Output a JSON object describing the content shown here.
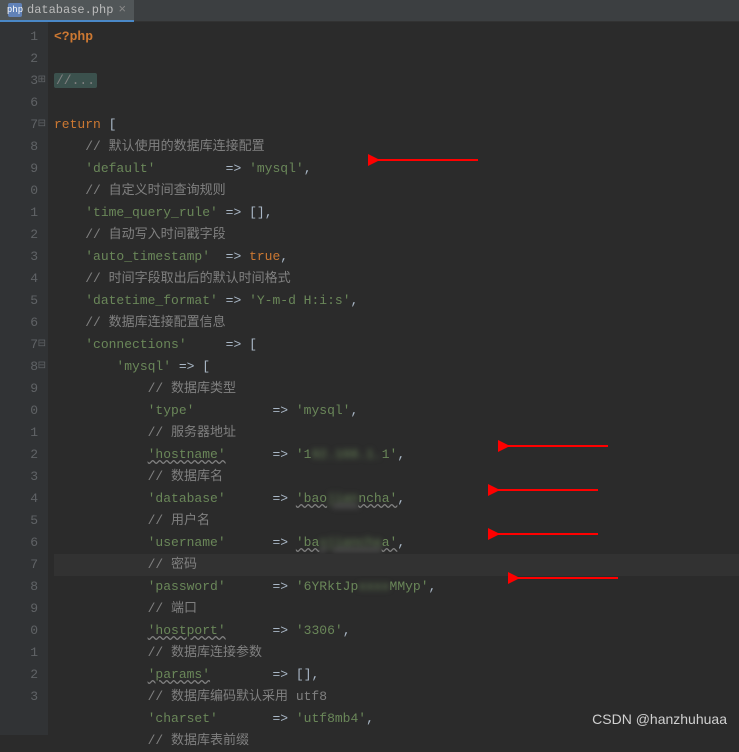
{
  "tab": {
    "label": "database.php",
    "icon": "php"
  },
  "gutter_lines": [
    "1",
    "2",
    "3",
    "6",
    "7",
    "8",
    "9",
    "0",
    "1",
    "2",
    "3",
    "4",
    "5",
    "6",
    "7",
    "8",
    "9",
    "0",
    "1",
    "2",
    "3",
    "4",
    "5",
    "6",
    "7",
    "8",
    "9",
    "0",
    "1",
    "2",
    "3"
  ],
  "code": {
    "php_open": "<?php",
    "fold": "//...",
    "return": "return",
    "cmt_default": "// 默认使用的数据库连接配置",
    "k_default": "'default'",
    "v_default": "'mysql'",
    "cmt_time_query": "// 自定义时间查询规则",
    "k_time_query": "'time_query_rule'",
    "v_time_query": "[]",
    "cmt_auto_ts": "// 自动写入时间戳字段",
    "k_auto_ts": "'auto_timestamp'",
    "v_auto_ts": "true",
    "cmt_dt_fmt": "// 时间字段取出后的默认时间格式",
    "k_dt_fmt": "'datetime_format'",
    "v_dt_fmt": "'Y-m-d H:i:s'",
    "cmt_conns": "// 数据库连接配置信息",
    "k_conns": "'connections'",
    "k_mysql": "'mysql'",
    "cmt_type": "// 数据库类型",
    "k_type": "'type'",
    "v_type": "'mysql'",
    "cmt_host": "// 服务器地址",
    "k_host": "'hostname'",
    "v_host_a": "'1",
    "v_host_blur": "92.168.1.",
    "v_host_b": "1'",
    "cmt_db": "// 数据库名",
    "k_db": "'database'",
    "v_db_a": "'bao",
    "v_db_blur": "jian",
    "v_db_b": "ncha'",
    "cmt_user": "// 用户名",
    "k_user": "'username'",
    "v_user_a": "'ba",
    "v_user_blur": "ojiancha",
    "v_user_b": "a'",
    "cmt_pwd": "// 密码",
    "k_pwd": "'password'",
    "v_pwd_a": "'6YRktJp",
    "v_pwd_blur": "xxxx",
    "v_pwd_b": "MMyp'",
    "cmt_port": "// 端口",
    "k_port": "'hostport'",
    "v_port": "'3306'",
    "cmt_params": "// 数据库连接参数",
    "k_params": "'params'",
    "v_params": "[]",
    "cmt_charset": "// 数据库编码默认采用 utf8",
    "k_charset": "'charset'",
    "v_charset": "'utf8mb4'",
    "cmt_prefix": "// 数据库表前缀"
  },
  "watermark": "CSDN @hanzhuhuaa"
}
